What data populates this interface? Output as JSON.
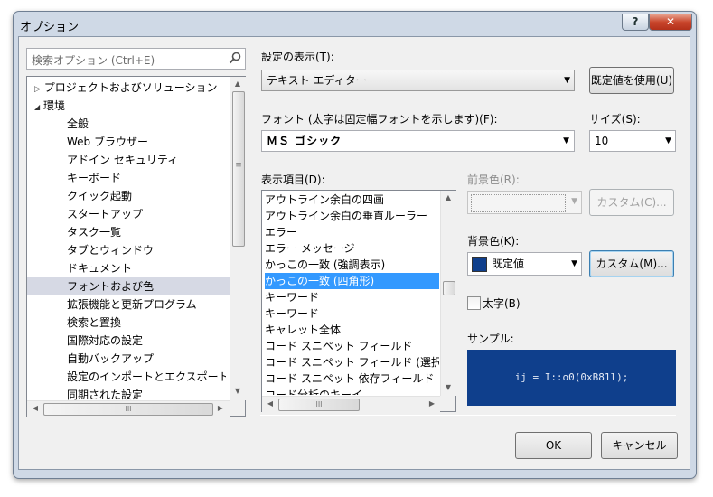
{
  "window": {
    "title": "オプション",
    "help_label": "?",
    "close_label": "✕"
  },
  "search": {
    "placeholder": "検索オプション (Ctrl+E)"
  },
  "tree": {
    "items": [
      {
        "label": "プロジェクトおよびソリューション",
        "expander": "▷",
        "level": 0
      },
      {
        "label": "環境",
        "expander": "◢",
        "level": 0
      },
      {
        "label": "全般",
        "level": 1
      },
      {
        "label": "Web ブラウザー",
        "level": 1
      },
      {
        "label": "アドイン セキュリティ",
        "level": 1
      },
      {
        "label": "キーボード",
        "level": 1
      },
      {
        "label": "クイック起動",
        "level": 1
      },
      {
        "label": "スタートアップ",
        "level": 1
      },
      {
        "label": "タスク一覧",
        "level": 1
      },
      {
        "label": "タブとウィンドウ",
        "level": 1
      },
      {
        "label": "ドキュメント",
        "level": 1
      },
      {
        "label": "フォントおよび色",
        "level": 1,
        "selected": true
      },
      {
        "label": "拡張機能と更新プログラム",
        "level": 1
      },
      {
        "label": "検索と置換",
        "level": 1
      },
      {
        "label": "国際対応の設定",
        "level": 1
      },
      {
        "label": "自動バックアップ",
        "level": 1
      },
      {
        "label": "設定のインポートとエクスポート",
        "level": 1
      },
      {
        "label": "同期された設定",
        "level": 1
      }
    ]
  },
  "settings": {
    "show_label": "設定の表示(T):",
    "show_value": "テキスト エディター",
    "default_button": "既定値を使用(U)",
    "font_label": "フォント (太字は固定幅フォントを示します)(F):",
    "font_value": "ＭＳ ゴシック",
    "size_label": "サイズ(S):",
    "size_value": "10"
  },
  "display_items": {
    "label": "表示項目(D):",
    "items": [
      "アウトライン余白の四画",
      "アウトライン余白の垂直ルーラー",
      "エラー",
      "エラー メッセージ",
      "かっこの一致 (強調表示)",
      "かっこの一致 (四角形)",
      "キーワード",
      "キーワード",
      "キャレット全体",
      "コード スニペット フィールド",
      "コード スニペット フィールド (選択",
      "コード スニペット 依存フィールド",
      "コード分析のキーイ"
    ],
    "selected_index": 5
  },
  "foreground": {
    "label": "前景色(R):",
    "custom_button": "カスタム(C)..."
  },
  "background": {
    "label": "背景色(K):",
    "value": "既定値",
    "custom_button": "カスタム(M)...",
    "swatch_color": "#0f3f8c"
  },
  "bold": {
    "label": "太字(B)",
    "checked": false
  },
  "sample": {
    "label": "サンプル:",
    "text": "ij = I::o0(0xB81l);"
  },
  "footer": {
    "ok": "OK",
    "cancel": "キャンセル"
  },
  "icons": {
    "search": "magnifier-icon",
    "dropdown": "▼",
    "up": "▲",
    "down": "▼",
    "left": "◀",
    "right": "▶",
    "grip": "≡",
    "hgrip": "III"
  }
}
